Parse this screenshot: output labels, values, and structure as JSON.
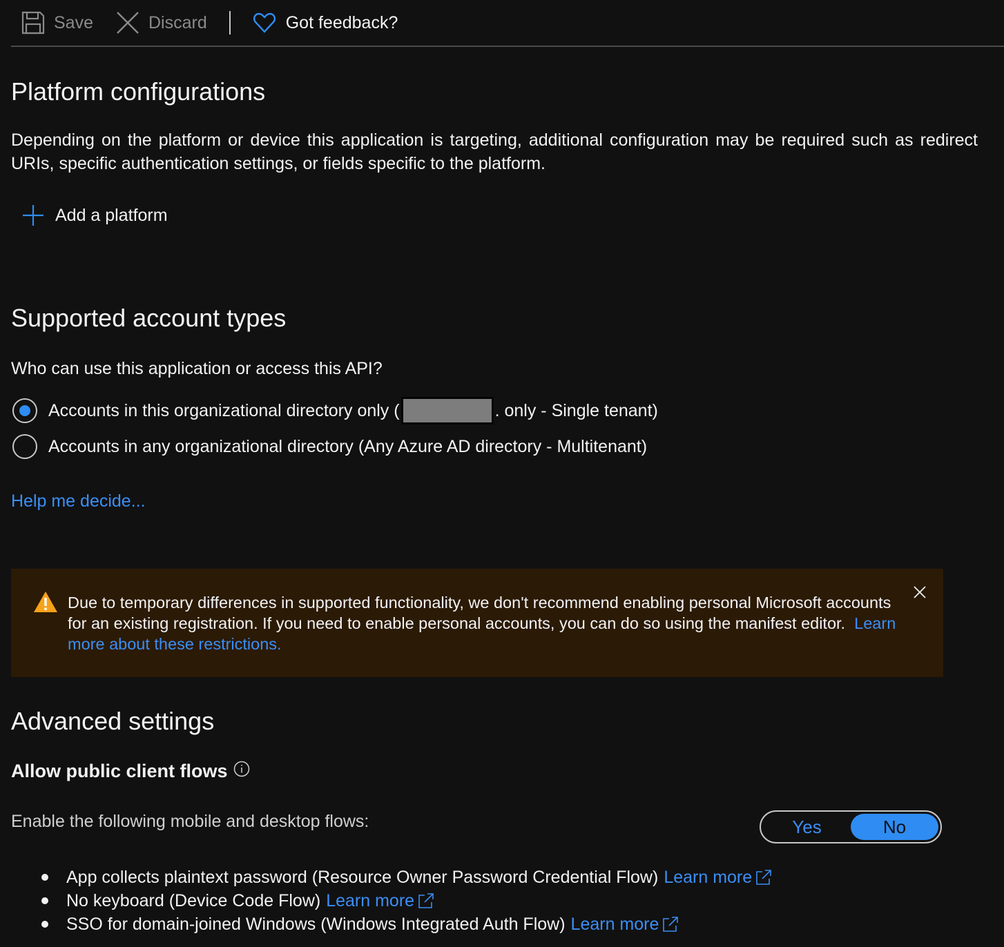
{
  "toolbar": {
    "save_label": "Save",
    "discard_label": "Discard",
    "feedback_label": "Got feedback?"
  },
  "platform": {
    "heading": "Platform configurations",
    "description": "Depending on the platform or device this application is targeting, additional configuration may be required such as redirect URIs, specific authentication settings, or fields specific to the platform.",
    "add_label": "Add a platform"
  },
  "accounts": {
    "heading": "Supported account types",
    "question": "Who can use this application or access this API?",
    "options": [
      {
        "label_before": "Accounts in this organizational directory only (",
        "label_after": ". only - Single tenant)",
        "checked": true
      },
      {
        "label": "Accounts in any organizational directory (Any Azure AD directory - Multitenant)",
        "checked": false
      }
    ],
    "help_link": "Help me decide..."
  },
  "warning": {
    "text": "Due to temporary differences in supported functionality, we don't recommend enabling personal Microsoft accounts for an existing registration. If you need to enable personal accounts, you can do so using the manifest editor.",
    "link": "Learn more about these restrictions."
  },
  "advanced": {
    "heading": "Advanced settings",
    "subheading": "Allow public client flows",
    "flows_label": "Enable the following mobile and desktop flows:",
    "toggle": {
      "yes": "Yes",
      "no": "No",
      "selected": "No"
    },
    "flows": [
      {
        "text": "App collects plaintext password (Resource Owner Password Credential Flow)",
        "link": "Learn more"
      },
      {
        "text": "No keyboard (Device Code Flow)",
        "link": "Learn more"
      },
      {
        "text": "SSO for domain-joined Windows (Windows Integrated Auth Flow)",
        "link": "Learn more"
      }
    ]
  },
  "colors": {
    "background": "#111111",
    "accent": "#2f8cf2",
    "link": "#3b8ef5",
    "warning_bg": "#2b1a05",
    "warning_icon": "#f7a21b"
  }
}
